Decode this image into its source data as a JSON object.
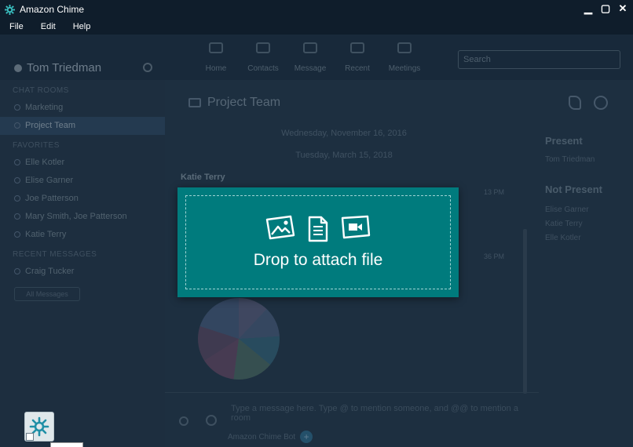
{
  "window": {
    "title": "Amazon Chime",
    "controls": [
      "minimize",
      "maximize",
      "close"
    ]
  },
  "menu": {
    "file": "File",
    "edit": "Edit",
    "help": "Help"
  },
  "user": {
    "name": "Tom Triedman"
  },
  "nav": {
    "tabs": [
      "Home",
      "Contacts",
      "Message",
      "Recent",
      "Meetings"
    ],
    "search_placeholder": "Search"
  },
  "sidebar": {
    "chat_rooms_header": "CHAT ROOMS",
    "rooms": [
      "Marketing",
      "Project Team"
    ],
    "favorites_header": "FAVORITES",
    "favorites": [
      "Elle Kotler",
      "Elise Garner",
      "Joe Patterson",
      "Mary Smith, Joe Patterson",
      "Katie Terry"
    ],
    "recent_header": "RECENT MESSAGES",
    "recent": [
      "Craig Tucker"
    ],
    "more_button": "All Messages"
  },
  "conversation": {
    "title": "Project Team",
    "date1": "Wednesday, November 16, 2016",
    "date2": "Tuesday, March 15, 2018",
    "author": "Katie Terry",
    "time1": "13 PM",
    "time2": "36 PM",
    "compose_placeholder": "Type a message here. Type @ to mention someone, and @@ to mention a room",
    "chime_in": "Amazon Chime Bot"
  },
  "attendees": {
    "present_header": "Present",
    "present": [
      "Tom Triedman"
    ],
    "not_present_header": "Not Present",
    "not_present": [
      "Elise Garner",
      "Katie Terry",
      "Elle Kotler"
    ]
  },
  "drop_overlay": {
    "message": "Drop to attach file",
    "icons": [
      "image-icon",
      "document-icon",
      "video-icon"
    ],
    "color": "#007b7d"
  },
  "colors": {
    "title_bar": "#0f1d2b",
    "accent": "#007b7d"
  }
}
